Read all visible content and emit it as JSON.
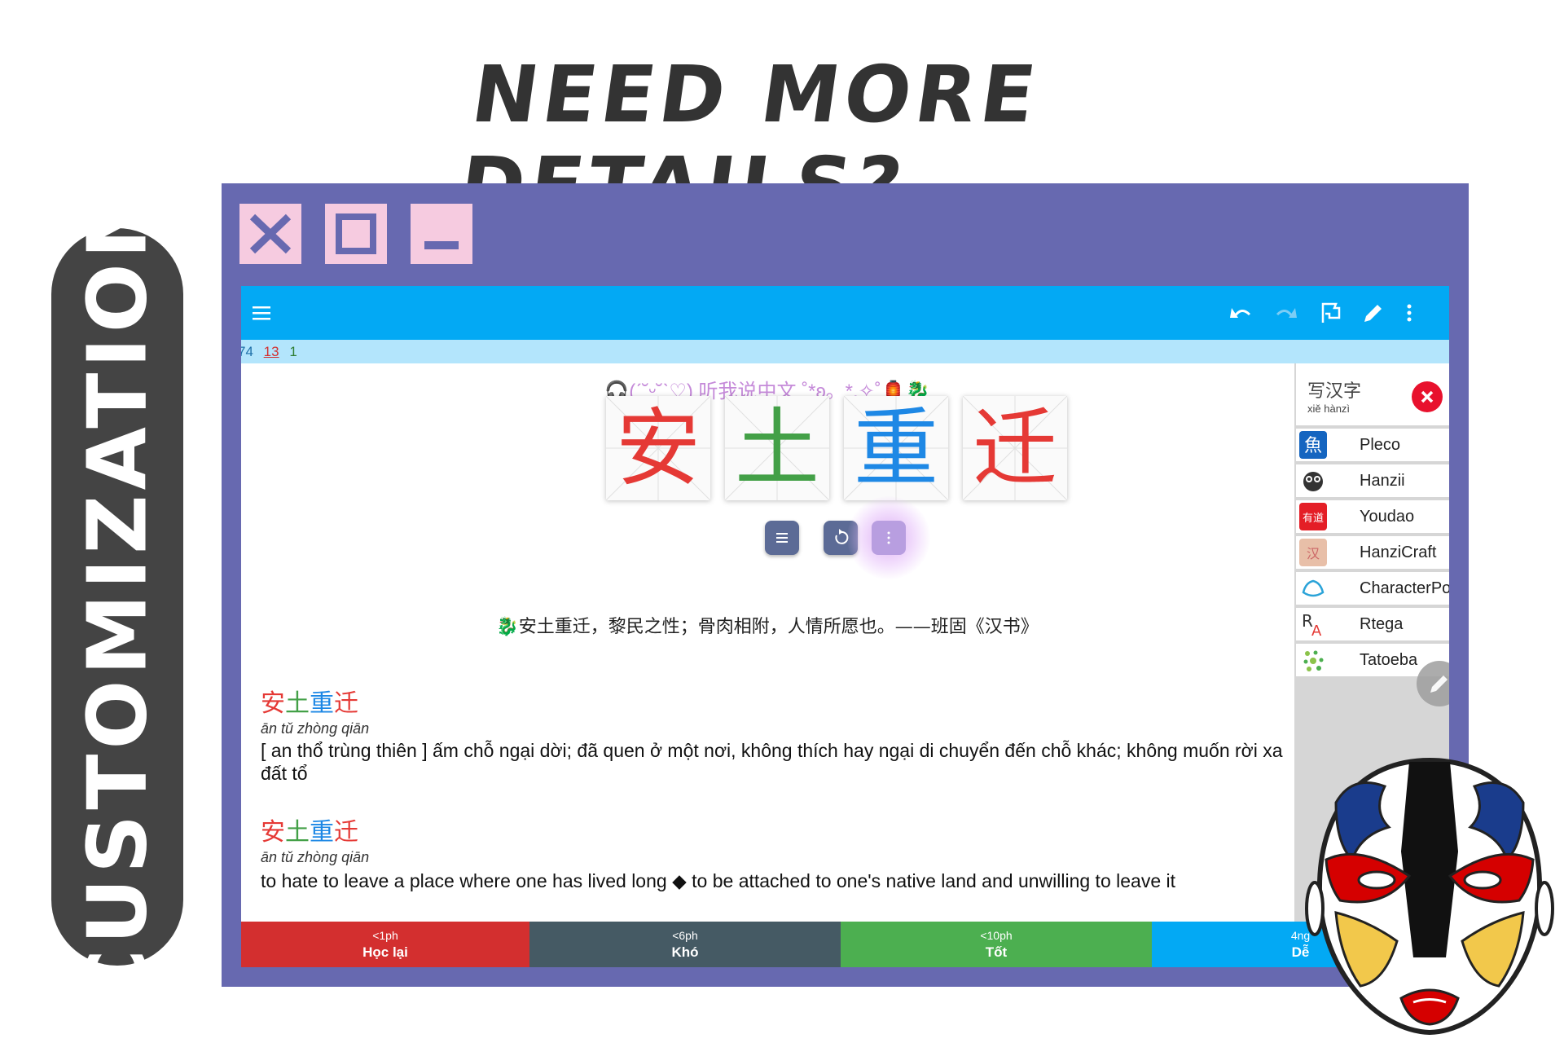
{
  "headline": "NEED MORE DETAILS?",
  "side_label": "CUSTOMIZATION",
  "window_buttons": [
    "close",
    "maximize",
    "minimize"
  ],
  "toolbar": {
    "menu_icon": "hamburger-menu-icon",
    "actions": [
      "undo-icon",
      "redo-icon",
      "flag-icon",
      "edit-icon",
      "more-vert-icon"
    ]
  },
  "counts": {
    "new": "74",
    "learning": "13",
    "review": "1"
  },
  "card": {
    "deco_line": "🎧(ˊ˘ᵕ˘ˋ♡) 听我说中文 ˚*ʚ。*.✧˚🏮🐉",
    "characters": [
      {
        "char": "安",
        "color": "#e53935"
      },
      {
        "char": "土",
        "color": "#43a047"
      },
      {
        "char": "重",
        "color": "#1e88e5"
      },
      {
        "char": "迁",
        "color": "#e53935"
      }
    ],
    "quote": "🐉安土重迁，黎民之性；骨肉相附，人情所愿也。——班固《汉书》",
    "entries": [
      {
        "word": [
          "安",
          "土",
          "重",
          "迁"
        ],
        "pinyin": "ān tǔ zhòng qiān",
        "definition": "[ an thổ trùng thiên ] ấm chỗ ngại dời; đã quen ở một nơi, không thích hay ngại di chuyển đến chỗ khác; không muốn rời xa đất tổ"
      },
      {
        "word": [
          "安",
          "土",
          "重",
          "迁"
        ],
        "pinyin": "ān tǔ zhòng qiān",
        "definition": "to hate to leave a place where one has lived long ◆ to be attached to one's native land and unwilling to leave it"
      }
    ]
  },
  "panel": {
    "title": "写汉字",
    "subtitle": "xiě hànzì",
    "items": [
      {
        "label": "Pleco",
        "icon": "pleco-logo-icon"
      },
      {
        "label": "Hanzii",
        "icon": "hanzii-logo-icon"
      },
      {
        "label": "Youdao",
        "icon": "youdao-logo-icon"
      },
      {
        "label": "HanziCraft",
        "icon": "hanzicraft-logo-icon"
      },
      {
        "label": "CharacterPop",
        "icon": "characterpop-logo-icon"
      },
      {
        "label": "Rtega",
        "icon": "rtega-logo-icon"
      },
      {
        "label": "Tatoeba",
        "icon": "tatoeba-logo-icon"
      }
    ]
  },
  "answers": [
    {
      "time": "<1ph",
      "label": "Học lại",
      "color": "#d32f2f"
    },
    {
      "time": "<6ph",
      "label": "Khó",
      "color": "#455a64"
    },
    {
      "time": "<10ph",
      "label": "Tốt",
      "color": "#4caf50"
    },
    {
      "time": "4ng",
      "label": "Dễ",
      "color": "#03a9f4"
    }
  ],
  "colors": {
    "frame": "#6769b0",
    "toolbar": "#03a9f4",
    "pill": "#444444",
    "window_button": "#f6cbe0"
  }
}
